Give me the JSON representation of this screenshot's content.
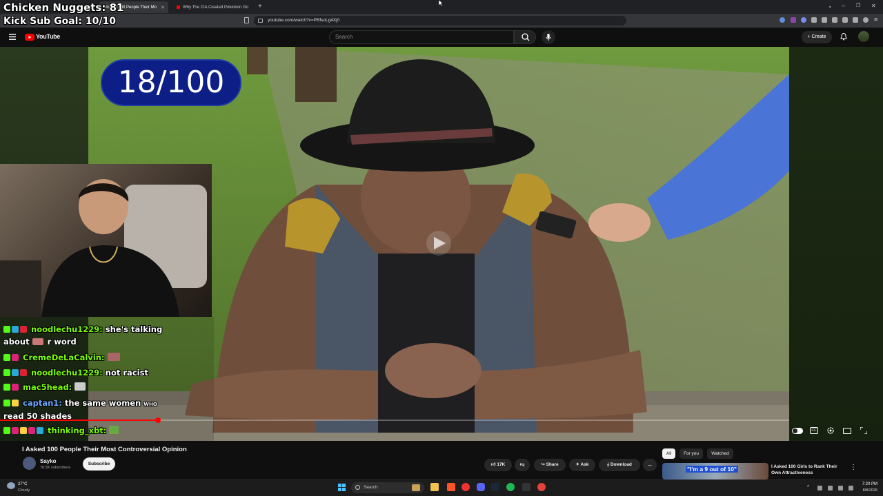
{
  "browser": {
    "tabs": [
      {
        "title": "I Asked 100 People Their Mo",
        "active": true
      },
      {
        "title": "Why The CIA Created Pokémon Go",
        "active": false
      }
    ],
    "new_tab": "+",
    "url": "youtube.com/watch?v=PBfsoLg4Xj0"
  },
  "overlay": {
    "line1": "Chicken Nuggets: 81",
    "line2": "Kick Sub Goal: 10/10"
  },
  "youtube": {
    "logo": "YouTube",
    "search_placeholder": "Search",
    "create_label": "Create"
  },
  "video": {
    "counter": "18/100",
    "progress_fraction": 0.2
  },
  "chat": {
    "messages": [
      {
        "user": "noodlechu1229:",
        "text": "she's talking",
        "text2": "about",
        "text3": "r word",
        "color": "green"
      },
      {
        "user": "CremeDeLaCalvin:",
        "text": "",
        "color": "green"
      },
      {
        "user": "noodlechu1229:",
        "text": "not racist",
        "color": "green"
      },
      {
        "user": "mac5head:",
        "text": "",
        "color": "green"
      },
      {
        "user": "captan1:",
        "text": "the same women",
        "text2": "read 50 shades",
        "extra": "WHO",
        "color": "blue"
      },
      {
        "user": "thinking_xbt:",
        "text": "",
        "color": "green"
      }
    ]
  },
  "below": {
    "title": "I Asked 100 People Their Most Controversial Opinion",
    "channel": "Sayko",
    "subscribers": "78.5K subscribers",
    "subscribe_label": "Subscribe",
    "likes": "17K",
    "share_label": "Share",
    "ask_label": "Ask",
    "download_label": "Download",
    "more_label": "..."
  },
  "recommendations": {
    "chips": [
      "All",
      "For you",
      "Watched"
    ],
    "first": {
      "thumb_text": "\"I'm a 9 out of 10\"",
      "title": "I Asked 100 Girls to Rank Their Own Attractiveness"
    }
  },
  "taskbar": {
    "weather_temp": "27°C",
    "weather_desc": "Cloudy",
    "search_label": "Search",
    "time": "7:20 PM",
    "date": "8/8/2026"
  }
}
